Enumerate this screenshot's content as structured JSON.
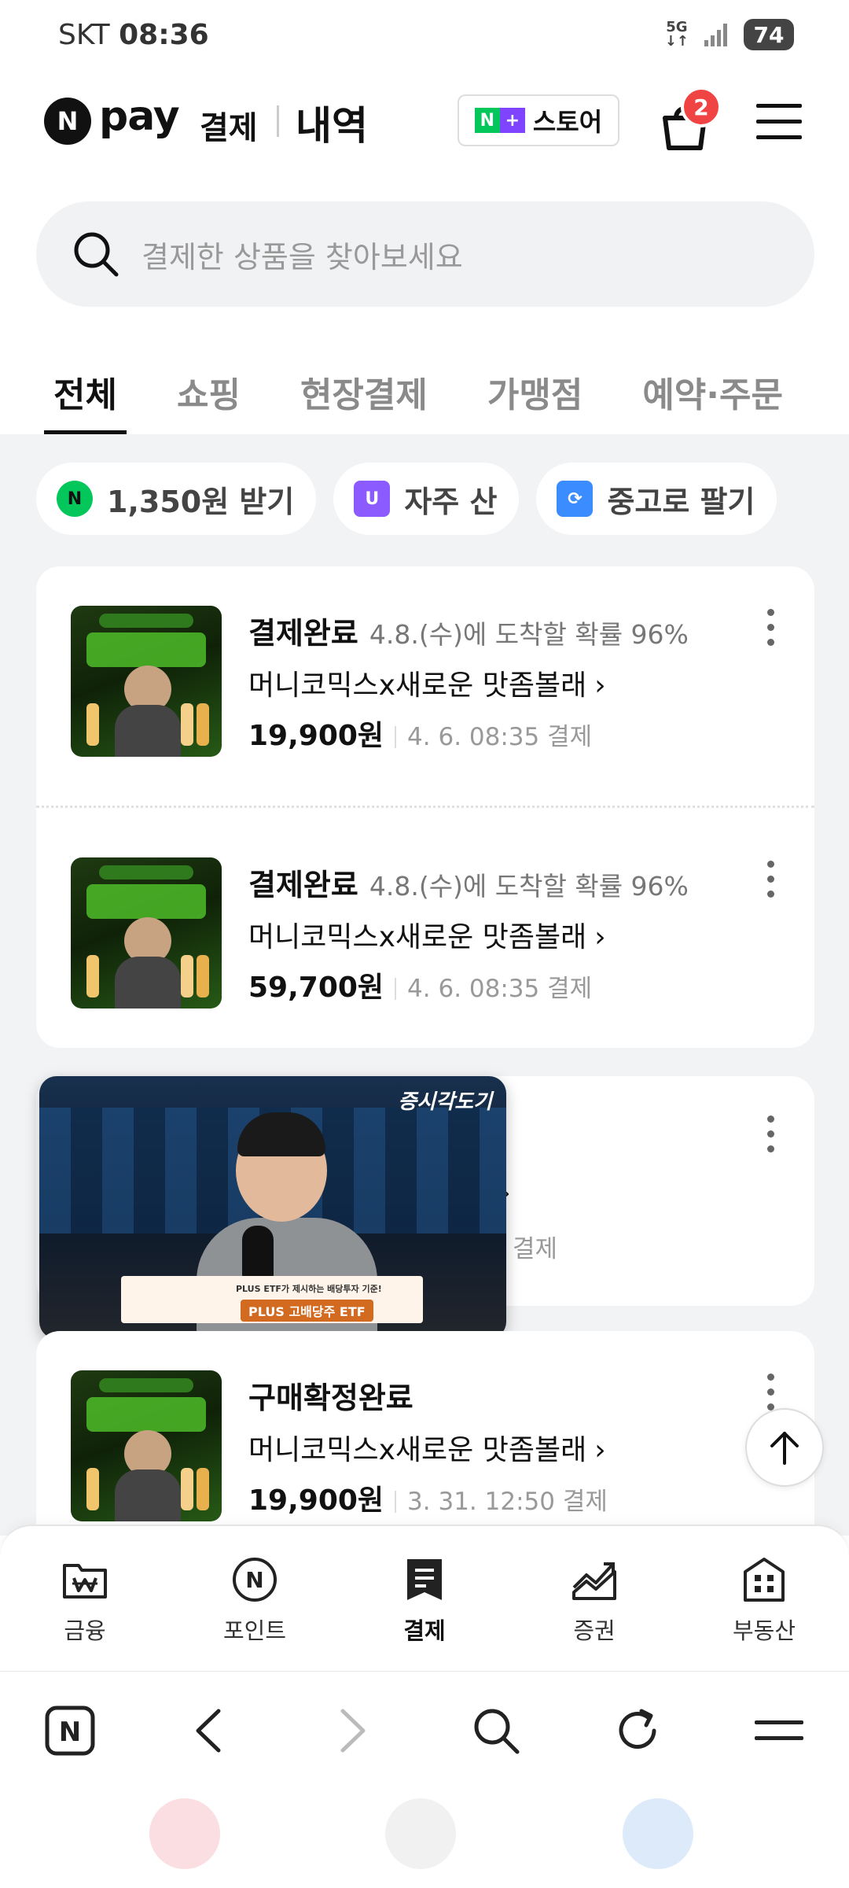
{
  "status_bar": {
    "carrier": "SKT",
    "time": "08:36",
    "network": "5G",
    "battery": "74"
  },
  "header": {
    "logo_letter": "N",
    "logo_pay": "pay",
    "logo_label": "결제",
    "section": "내역",
    "store_button": "스토어",
    "cart_count": "2"
  },
  "search": {
    "placeholder": "결제한 상품을 찾아보세요"
  },
  "tabs": [
    {
      "label": "전체",
      "active": true
    },
    {
      "label": "쇼핑"
    },
    {
      "label": "현장결제"
    },
    {
      "label": "가맹점"
    },
    {
      "label": "예약·주문"
    }
  ],
  "chips": [
    {
      "label": "1,350원 받기",
      "icon": "npay-point-icon"
    },
    {
      "label": "자주 산",
      "icon": "shopping-bag-icon"
    },
    {
      "label": "중고로 팔기",
      "icon": "recycle-icon"
    }
  ],
  "orders": [
    {
      "status": "결제완료",
      "eta": "4.8.(수)에 도착할 확률 96%",
      "product": "머니코믹스x새로운 맛좀볼래",
      "price": "19,900원",
      "date": "4. 6. 08:35 결제"
    },
    {
      "status": "결제완료",
      "eta": "4.8.(수)에 도착할 확률 96%",
      "product": "머니코믹스x새로운 맛좀볼래",
      "price": "59,700원",
      "date": "4. 6. 08:35 결제"
    },
    {
      "partial_text": "결제"
    },
    {
      "status": "구매확정완료",
      "product": "머니코믹스x새로운 맛좀볼래",
      "price": "19,900원",
      "date": "3. 31. 12:50 결제"
    }
  ],
  "video_overlay": {
    "brand": "증시각도기",
    "banner_top": "PLUS ETF가 제시하는 배당투자 기준!",
    "banner_main": "PLUS 고배당주 ETF"
  },
  "bottom_nav": [
    {
      "label": "금융",
      "icon": "wallet-won-icon"
    },
    {
      "label": "포인트",
      "icon": "point-icon"
    },
    {
      "label": "결제",
      "icon": "receipt-icon",
      "active": true
    },
    {
      "label": "증권",
      "icon": "stock-chart-icon"
    },
    {
      "label": "부동산",
      "icon": "building-icon"
    }
  ],
  "browser_bar": {
    "home_letter": "N"
  }
}
